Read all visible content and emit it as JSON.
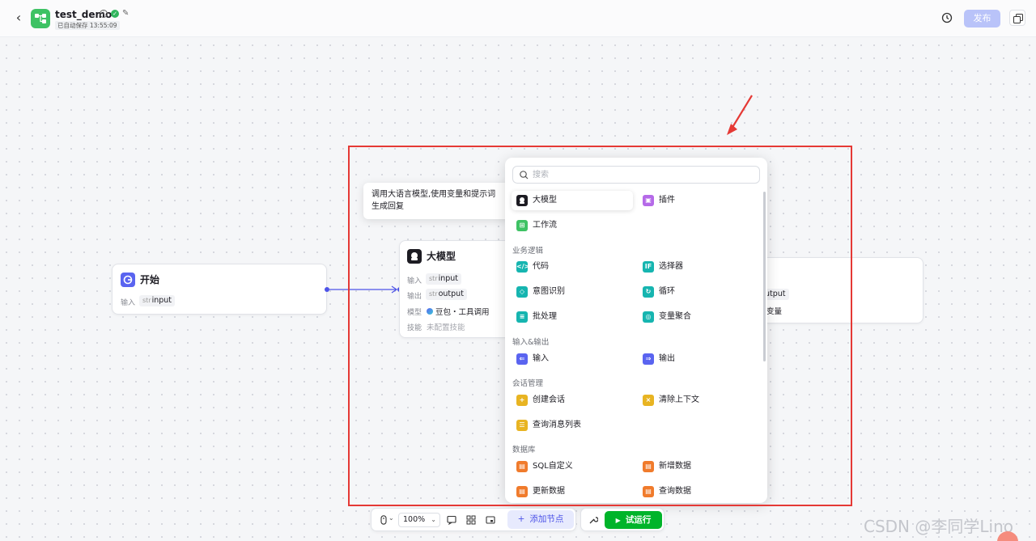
{
  "header": {
    "back_icon": "chevron-left-icon",
    "app_icon": "workflow-icon",
    "title": "test_demo",
    "autosave_text": "已自动保存 13:55:09",
    "publish_label": "发布",
    "history_icon": "history-icon",
    "copy_icon": "copy-icon"
  },
  "nodes": {
    "start": {
      "title": "开始",
      "input_label": "输入",
      "input_type": "str",
      "input_name": "input"
    },
    "llm": {
      "title": "大模型",
      "input_label": "输入",
      "input_type": "str",
      "input_name": "input",
      "output_label": "输出",
      "output_type": "str",
      "output_name": "output",
      "model_label": "模型",
      "model_value": "豆包・工具调用",
      "skill_label": "技能",
      "skill_value": "未配置技能"
    },
    "end": {
      "output_partial": "utput",
      "var_partial": "变量"
    }
  },
  "tooltip": {
    "line1": "调用大语言模型,使用变量和提示词",
    "line2": "生成回复"
  },
  "popup": {
    "search_placeholder": "搜索",
    "items_top": [
      {
        "label": "大模型",
        "icon": "llm-icon",
        "color": "#1d1c23"
      },
      {
        "label": "插件",
        "icon": "plugin-icon",
        "color": "#b56ae8"
      },
      {
        "label": "工作流",
        "icon": "workflow-icon",
        "color": "#3ec264"
      }
    ],
    "sections": [
      {
        "title": "业务逻辑",
        "items": [
          {
            "label": "代码",
            "icon": "code-icon",
            "color": "#16b5b0"
          },
          {
            "label": "选择器",
            "icon": "if-icon",
            "color": "#16b5b0"
          },
          {
            "label": "意图识别",
            "icon": "intent-icon",
            "color": "#16b5b0"
          },
          {
            "label": "循环",
            "icon": "loop-icon",
            "color": "#16b5b0"
          },
          {
            "label": "批处理",
            "icon": "batch-icon",
            "color": "#16b5b0"
          },
          {
            "label": "变量聚合",
            "icon": "aggregate-icon",
            "color": "#16b5b0"
          }
        ]
      },
      {
        "title": "输入&输出",
        "items": [
          {
            "label": "输入",
            "icon": "input-icon",
            "color": "#5a64f0"
          },
          {
            "label": "输出",
            "icon": "output-icon",
            "color": "#5a64f0"
          }
        ]
      },
      {
        "title": "会话管理",
        "items": [
          {
            "label": "创建会话",
            "icon": "create-chat-icon",
            "color": "#e8b422"
          },
          {
            "label": "清除上下文",
            "icon": "clear-context-icon",
            "color": "#e8b422"
          },
          {
            "label": "查询消息列表",
            "icon": "message-list-icon",
            "color": "#e8b422"
          }
        ]
      },
      {
        "title": "数据库",
        "items": [
          {
            "label": "SQL自定义",
            "icon": "sql-icon",
            "color": "#f07b2c"
          },
          {
            "label": "新增数据",
            "icon": "add-data-icon",
            "color": "#f07b2c"
          },
          {
            "label": "更新数据",
            "icon": "update-data-icon",
            "color": "#f07b2c"
          },
          {
            "label": "查询数据",
            "icon": "query-data-icon",
            "color": "#f07b2c"
          }
        ]
      }
    ]
  },
  "toolbar": {
    "zoom": "100%",
    "add_node_label": "添加节点",
    "run_label": "试运行"
  },
  "watermark": "CSDN @李同学Lino"
}
